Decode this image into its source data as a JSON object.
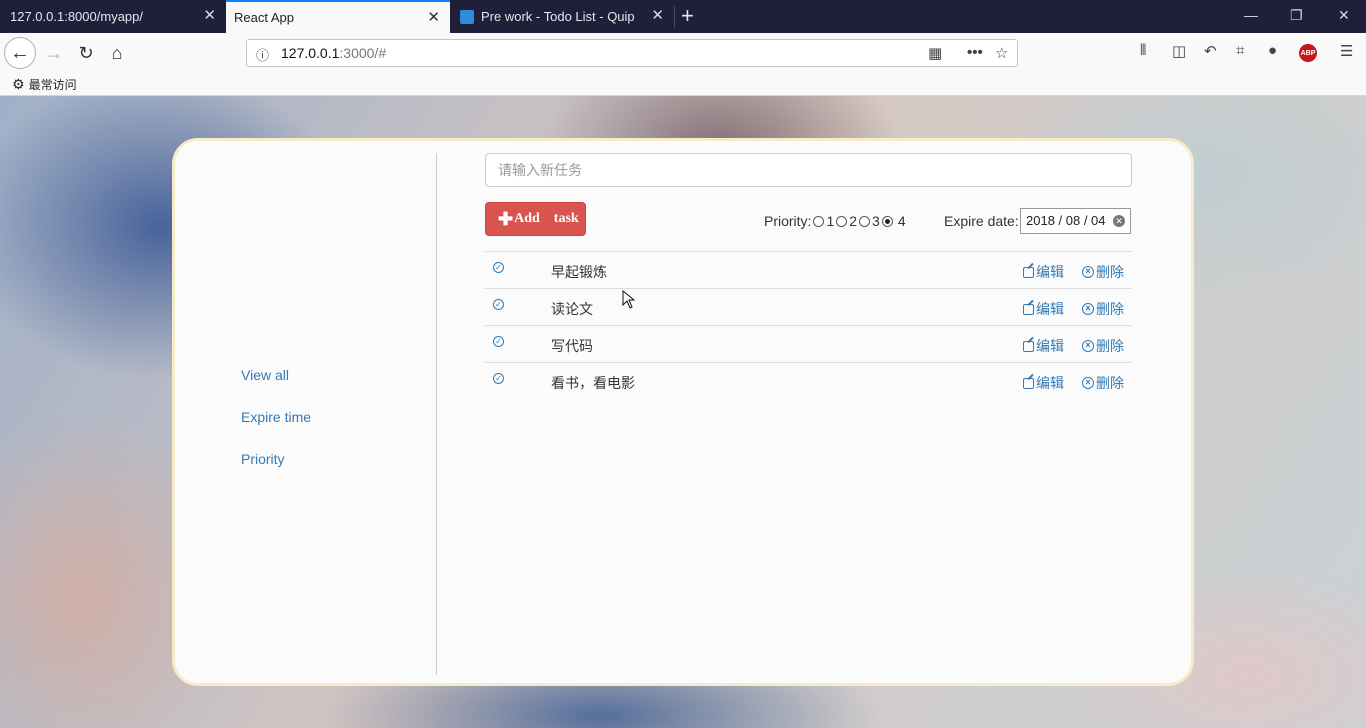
{
  "browser": {
    "tabs": [
      {
        "label": "127.0.0.1:8000/myapp/",
        "active": false
      },
      {
        "label": "React App",
        "active": true
      },
      {
        "label": "Pre work - Todo List - Quip",
        "active": false
      }
    ],
    "close_glyph": "✕",
    "new_tab_glyph": "+",
    "window_controls": {
      "minimize": "—",
      "restore": "❐",
      "close": "✕"
    },
    "url": {
      "host": "127.0.0.1",
      "rest": ":3000/#"
    },
    "bookmark": "最常访问"
  },
  "app": {
    "sidebar": [
      {
        "label": "View all"
      },
      {
        "label": "Expire time"
      },
      {
        "label": "Priority"
      }
    ],
    "new_task": {
      "placeholder": "请输入新任务",
      "value": ""
    },
    "add_button": {
      "plus": "✚",
      "word1": "Add",
      "word2": "task"
    },
    "priority": {
      "label": "Priority:",
      "options": [
        "1",
        "2",
        "3",
        "4"
      ],
      "selected": "4"
    },
    "expire": {
      "label": "Expire date:",
      "value": "2018 / 08 / 04"
    },
    "actions": {
      "edit": "编辑",
      "delete": "删除"
    },
    "tasks": [
      {
        "name": "早起锻炼"
      },
      {
        "name": "读论文"
      },
      {
        "name": "写代码"
      },
      {
        "name": "看书，看电影"
      }
    ]
  },
  "colors": {
    "accent": "#0a84ff",
    "link": "#337ab7",
    "danger": "#d9534f",
    "card_border": "#f7ecc8"
  }
}
